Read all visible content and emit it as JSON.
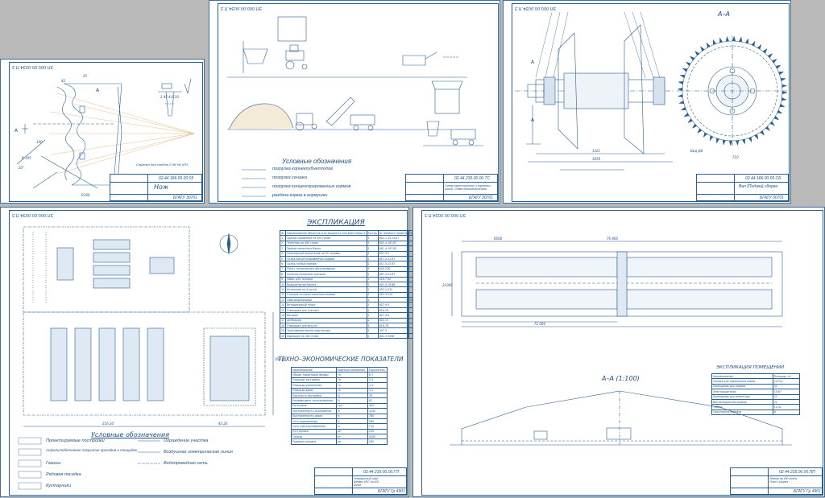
{
  "sheets": {
    "knife": {
      "code": "ЭЛ 000.00.00Э4.П.З",
      "ruled_note": "Стрелки для стебля 2 НК НК 0ПЗ",
      "title_code": "02.44 186.00.00.05",
      "title_name": "Нож",
      "org": "БГАТУ 30701",
      "dims": {
        "d1": "25",
        "d2": "42",
        "d3": "2 45 4,6 10",
        "d4": "R180",
        "d5": "R 105",
        "d6": "20°",
        "d7": "100",
        "d8": "A",
        "d9": "A"
      }
    },
    "scheme": {
      "code": "ЭЛ 000.00.00Э4.П.З",
      "legend_title": "Условные обозначения",
      "legend": [
        "погрузка корнеклубнеплодов",
        "погрузка сенажа",
        "погрузка концентрированных кормов",
        "раздача корма в кормушки"
      ],
      "title_code": "02.44 235.00.00.ТС",
      "title_name": "Схема транспортных и кормовых линий. Схема технологическая",
      "org": "БГАТУ 30701"
    },
    "drum": {
      "code": "ЭЛ 000.00.00Э4.П.З",
      "section": "А–А",
      "title_code": "02.44 186.00.00.СБ",
      "title_name": "Вал (Подача) сборка",
      "org": "БГАТУ 30701",
      "dims": {
        "w1": "1321",
        "w2": "1850",
        "w3": "710",
        "w4": "Вид ф8",
        "a": "А",
        "b": "А"
      }
    },
    "plan": {
      "code": "ЭЛ 000.00.00Э4.П.З",
      "expl_title": "ЭКСПЛИКАЦИЯ",
      "expl_headers": [
        "№",
        "Наименование объектов и их мощность или вместимость",
        "Кол-во",
        "№ типового проекта",
        "Примечание"
      ],
      "expl_rows": [
        [
          "1",
          "Здание коровника на 400 голов",
          "1",
          "801-1-35.13.87",
          ""
        ],
        [
          "2",
          "Телятник на 400 голов",
          "1",
          "801-4-187.87",
          ""
        ],
        [
          "3",
          "Здание молочного блока",
          "1",
          "801-4-197.83",
          ""
        ],
        [
          "4",
          "Санитарный пропускник на 30 человек",
          "1",
          "807-9-2",
          ""
        ],
        [
          "5",
          "Склад концентрированных кормов",
          "1",
          "811-5-22.87",
          ""
        ],
        [
          "6",
          "Склад грубых кормов",
          "1",
          "811-5-22.87",
          ""
        ],
        [
          "7",
          "Пункт технического обслуживания",
          "1",
          "816-228",
          ""
        ],
        [
          "8",
          "Силосно-сенажные траншеи",
          "1",
          "801-9-22.87",
          ""
        ],
        [
          "9",
          "Навес для техники",
          "1",
          "416-7-90",
          ""
        ],
        [
          "10",
          "Водонапорная башня",
          "1",
          "901-5-29.86",
          ""
        ],
        [
          "11",
          "Котельная на 4 котла",
          "1",
          "903-1-231",
          ""
        ],
        [
          "12",
          "Станция по приготовлению кормов",
          "1",
          "801-9-225",
          ""
        ],
        [
          "13",
          "Навозохранилище",
          "1",
          "",
          "НП-30"
        ],
        [
          "14",
          "Ветеринарный пункт",
          "1",
          "807-9-5",
          ""
        ],
        [
          "15",
          "Площадка для техники",
          "1",
          "816-29",
          ""
        ],
        [
          "16",
          "Весовая",
          "1",
          "807-9-6",
          ""
        ],
        [
          "17",
          "Дезбарьер",
          "2",
          "802-15",
          ""
        ],
        [
          "18",
          "Площадка для выгула",
          "1",
          "816-78",
          ""
        ],
        [
          "19",
          "Трансформаторная подстанция",
          "1",
          "407-3",
          ""
        ],
        [
          "20",
          "Кормоцех на 400 голов",
          "1",
          "801-3-3098",
          ""
        ]
      ],
      "tep_title": "ТЕХНО–ЭКОНОМИЧЕСКИЕ ПОКАЗАТЕЛИ",
      "tep_headers": [
        "Наименование",
        "Единица измерения",
        "Показатель"
      ],
      "tep_rows": [
        [
          "Общая территория фермы",
          "га",
          "6,7"
        ],
        [
          "Площадь застройки",
          "га",
          "2,4"
        ],
        [
          "Площадь озеленения",
          "га",
          "1,4"
        ],
        [
          "Площадь дорог",
          "га",
          "1,2"
        ],
        [
          "Плотность застройки",
          "%",
          "35"
        ],
        [
          "Коэффициент использования",
          "%",
          "62"
        ],
        [
          "Поголовье",
          "гол",
          "400"
        ],
        [
          "Протяжённость ограждения",
          "м",
          "1040"
        ],
        [
          "Протяжённость дорог",
          "м",
          "780"
        ],
        [
          "Сеть водопровода",
          "м",
          "560"
        ],
        [
          "Сеть электроснабжения",
          "м",
          "710"
        ],
        [
          "Кустарники",
          "шт",
          "220"
        ],
        [
          "Газоны",
          "м²",
          "4200"
        ],
        [
          "Рядовые посадки",
          "шт",
          "260"
        ]
      ],
      "legend_title": "Условные обозначения",
      "legend_left": [
        "Проектируемые постройки",
        "Асфальтобетонное покрытие проездов и площадок",
        "Газоны",
        "Рядовая посадка",
        "Кустарники"
      ],
      "legend_right": [
        "Ограждение участка",
        "Воздушная электрическая линия",
        "Водопроводная сеть"
      ],
      "dim_x1": "216.20",
      "dim_x2": "43.20",
      "dim_y": "208.50",
      "title_code": "02.44 235.00.00.ГП",
      "title_name": "Генеральный план фермы КРС на 400 голов",
      "org": "БГАТУ Гр 4901"
    },
    "barn": {
      "code": "ЭЛ 000.00.00Э4.П.З",
      "dim_total": "76 800",
      "dim_inner": "72 000",
      "dim_bay": "6000",
      "dim_h": "21000",
      "section": "А–А (1:100)",
      "expl_title": "ЭКСПЛИКАЦИЯ ПОМЕЩЕНИЙ",
      "expl_headers": [
        "Наименование",
        "Площадь, м²"
      ],
      "expl_rows": [
        [
          "Секция для содержания коров",
          "1279,2"
        ],
        [
          "Помещение для кормов",
          "42"
        ],
        [
          "Электрощитовая",
          "10,67"
        ],
        [
          "Помещение для инвентаря",
          "21"
        ],
        [
          "Вентиляционная камера",
          "21"
        ],
        [
          "Тамбур",
          "14,01"
        ],
        [
          "Санитарная комната",
          "6"
        ]
      ],
      "title_code": "02.44 235.00.00.ПП",
      "title_name": "Здание на 400 голов. План и разрез",
      "org": "БГАТУ Гр 4901"
    }
  }
}
